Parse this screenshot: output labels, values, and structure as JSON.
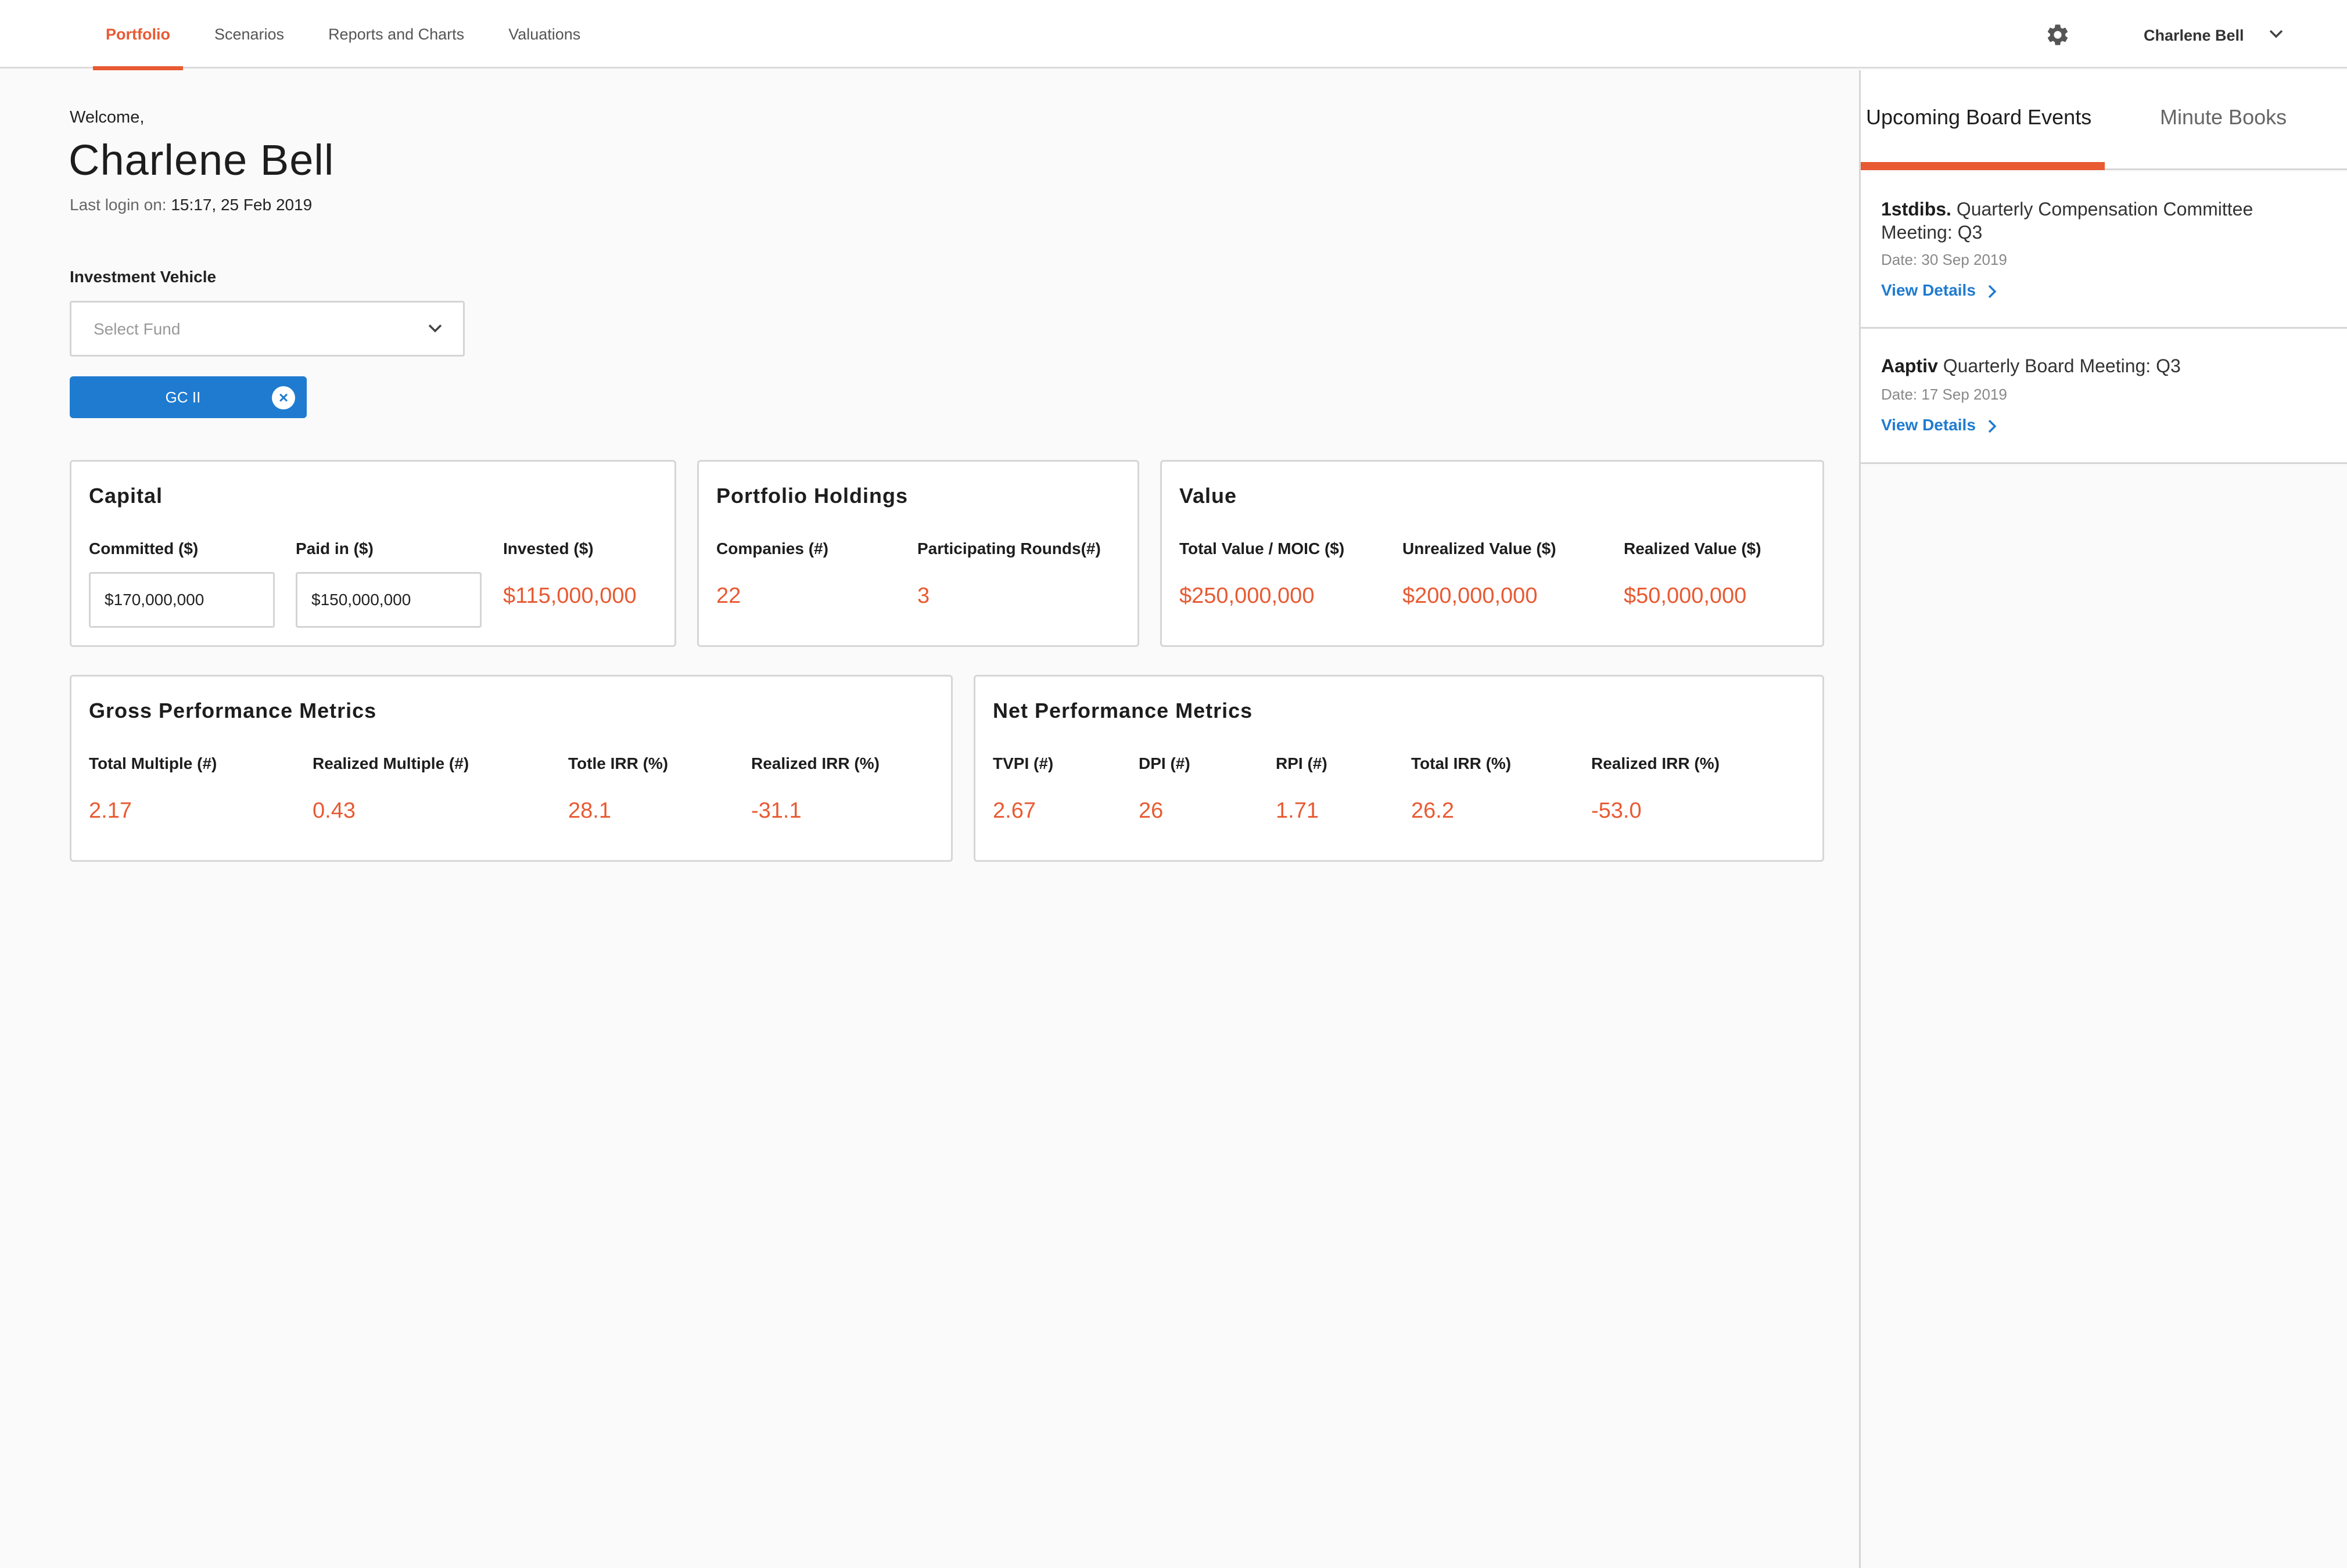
{
  "nav": {
    "items": [
      {
        "label": "Portfolio",
        "active": true
      },
      {
        "label": "Scenarios",
        "active": false
      },
      {
        "label": "Reports and Charts",
        "active": false
      },
      {
        "label": "Valuations",
        "active": false
      }
    ],
    "user_name": "Charlene Bell",
    "icons": {
      "settings": "gear-icon",
      "user_menu": "chevron-down-icon"
    }
  },
  "welcome": {
    "greeting": "Welcome,",
    "name": "Charlene Bell",
    "last_login_label": "Last login on:",
    "last_login_value": "15:17, 25 Feb 2019"
  },
  "investment_vehicle": {
    "label": "Investment Vehicle",
    "placeholder": "Select Fund",
    "selected_chip": "GC II"
  },
  "capital": {
    "title": "Capital",
    "committed_label": "Committed ($)",
    "committed_value": "$170,000,000",
    "paid_in_label": "Paid in ($)",
    "paid_in_value": "$150,000,000",
    "invested_label": "Invested ($)",
    "invested_value": "$115,000,000"
  },
  "holdings": {
    "title": "Portfolio Holdings",
    "companies_label": "Companies (#)",
    "companies_value": "22",
    "rounds_label": "Participating Rounds(#)",
    "rounds_value": "3"
  },
  "value": {
    "title": "Value",
    "total_label": "Total Value / MOIC ($)",
    "total_value": "$250,000,000",
    "unrealized_label": "Unrealized Value ($)",
    "unrealized_value": "$200,000,000",
    "realized_label": "Realized Value ($)",
    "realized_value": "$50,000,000"
  },
  "gross": {
    "title": "Gross Performance Metrics",
    "metrics": [
      {
        "label": "Total Multiple (#)",
        "value": "2.17"
      },
      {
        "label": "Realized Multiple (#)",
        "value": "0.43"
      },
      {
        "label": "Totle IRR (%)",
        "value": "28.1"
      },
      {
        "label": "Realized IRR (%)",
        "value": "-31.1"
      }
    ]
  },
  "net": {
    "title": "Net Performance Metrics",
    "metrics": [
      {
        "label": "TVPI (#)",
        "value": "2.67"
      },
      {
        "label": "DPI (#)",
        "value": "26"
      },
      {
        "label": "RPI (#)",
        "value": "1.71"
      },
      {
        "label": "Total IRR (%)",
        "value": "26.2"
      },
      {
        "label": "Realized IRR (%)",
        "value": "-53.0"
      }
    ]
  },
  "sidebar": {
    "tabs": [
      {
        "label": "Upcoming Board Events",
        "active": true
      },
      {
        "label": "Minute Books",
        "active": false
      }
    ],
    "events": [
      {
        "company": "1stdibs.",
        "title": "Quarterly Compensation Committee Meeting: Q3",
        "date": "Date: 30 Sep 2019",
        "link": "View Details"
      },
      {
        "company": "Aaptiv",
        "title": "Quarterly Board Meeting: Q3",
        "date": "Date: 17 Sep 2019",
        "link": "View Details"
      }
    ]
  },
  "colors": {
    "accent": "#e85a32",
    "link": "#1f7bd0",
    "chip": "#1f7bd0"
  }
}
